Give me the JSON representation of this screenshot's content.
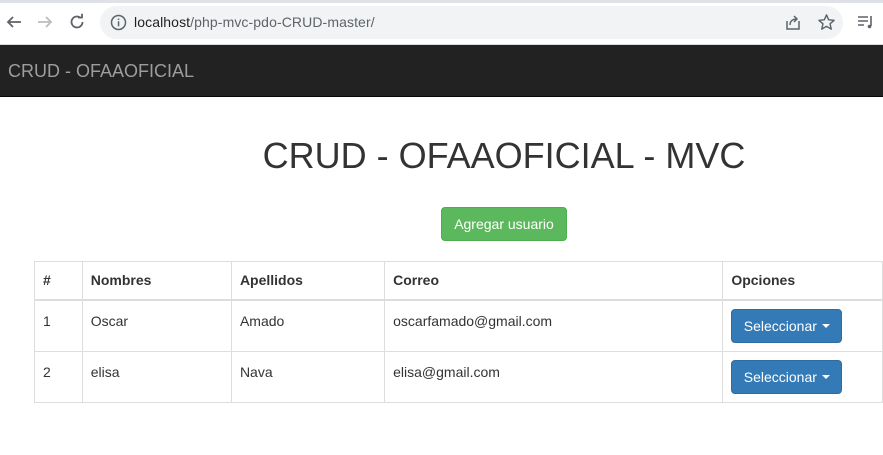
{
  "browser": {
    "url_host": "localhost",
    "url_path": "/php-mvc-pdo-CRUD-master/",
    "icons": [
      "back-arrow-icon",
      "forward-arrow-icon",
      "reload-icon",
      "site-info-icon",
      "share-icon",
      "star-icon",
      "reading-list-icon"
    ]
  },
  "navbar": {
    "brand": "CRUD - OFAAOFICIAL"
  },
  "main": {
    "title": "CRUD - OFAAOFICIAL - MVC",
    "add_button": "Agregar usuario"
  },
  "table": {
    "headers": [
      "#",
      "Nombres",
      "Apellidos",
      "Correo",
      "Opciones"
    ],
    "rows": [
      {
        "id": "1",
        "nombres": "Oscar",
        "apellidos": "Amado",
        "correo": "oscarfamado@gmail.com",
        "action": "Seleccionar"
      },
      {
        "id": "2",
        "nombres": "elisa",
        "apellidos": "Nava",
        "correo": "elisa@gmail.com",
        "action": "Seleccionar"
      }
    ]
  },
  "colors": {
    "navbar_bg": "#222222",
    "success": "#5cb85c",
    "primary": "#337ab7"
  }
}
